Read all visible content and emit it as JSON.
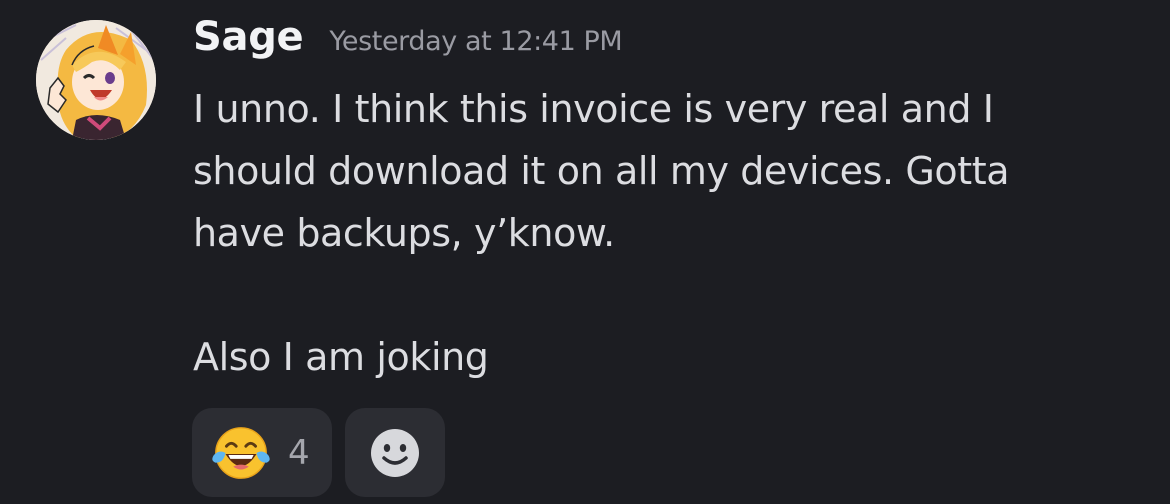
{
  "message": {
    "author": "Sage",
    "timestamp": "Yesterday at 12:41 PM",
    "lines": [
      "I unno. I think this invoice is very real and I",
      "should download it on all my devices. Gotta",
      "have backups, y’know.",
      "",
      "Also I am joking"
    ]
  },
  "avatar": {
    "icon": "anime-character-avatar-icon"
  },
  "reactions": [
    {
      "icon": "joy-emoji-icon",
      "emoji": "😂",
      "count": "4"
    }
  ],
  "add_reaction": {
    "icon": "smiley-add-reaction-icon"
  },
  "colors": {
    "background": "#1c1d22",
    "username": "#f2f3f5",
    "timestamp": "#9a9ba3",
    "text": "#dcdde1",
    "reaction_bg": "#2c2d33",
    "reaction_count": "#a5a6ad"
  }
}
